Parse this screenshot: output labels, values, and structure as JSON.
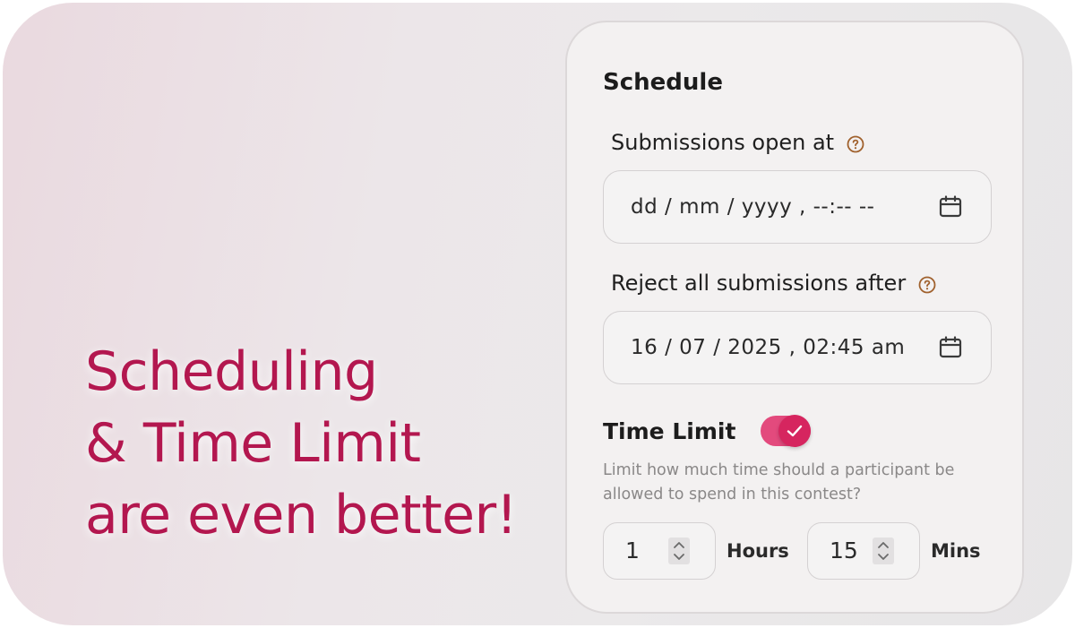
{
  "headline": {
    "line1": "Scheduling",
    "line2": "& Time Limit",
    "line3": "are even better!"
  },
  "schedule": {
    "title": "Schedule",
    "open": {
      "label": "Submissions open at",
      "value": "dd / mm / yyyy ,  --:--  --",
      "help_icon": "question-circle-icon",
      "calendar_icon": "calendar-icon"
    },
    "reject": {
      "label": "Reject all submissions after",
      "value": "16 / 07 / 2025 ,  02:45   am",
      "help_icon": "question-circle-icon",
      "calendar_icon": "calendar-icon"
    }
  },
  "time_limit": {
    "label": "Time Limit",
    "enabled": true,
    "description": "Limit how much time should a participant be allowed to spend in this contest?",
    "hours": {
      "value": "1",
      "unit": "Hours"
    },
    "minutes": {
      "value": "15",
      "unit": "Mins"
    }
  },
  "colors": {
    "accent": "#b3174f",
    "toggle_on": "#e34a7d",
    "help_icon": "#a0612d"
  }
}
